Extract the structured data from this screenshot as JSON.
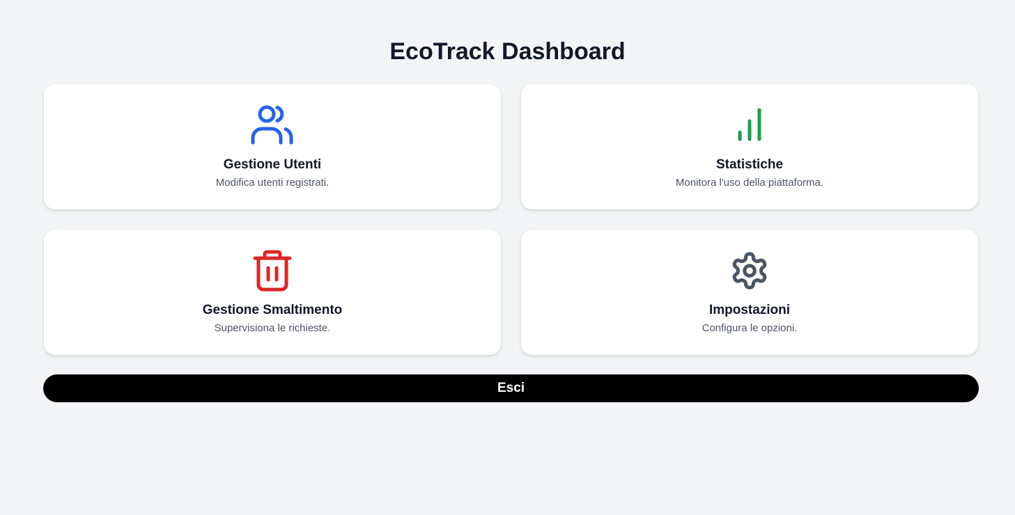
{
  "header": {
    "title": "EcoTrack Dashboard"
  },
  "cards": [
    {
      "title": "Gestione Utenti",
      "description": "Modifica utenti registrati.",
      "icon": "users-icon",
      "icon_color": "#2563eb"
    },
    {
      "title": "Statistiche",
      "description": "Monitora l'uso della piattaforma.",
      "icon": "bar-chart-icon",
      "icon_color": "#16a34a"
    },
    {
      "title": "Gestione Smaltimento",
      "description": "Supervisiona le richieste.",
      "icon": "trash-icon",
      "icon_color": "#dc2626"
    },
    {
      "title": "Impostazioni",
      "description": "Configura le opzioni.",
      "icon": "gear-icon",
      "icon_color": "#4b5563"
    }
  ],
  "logout": {
    "label": "Esci"
  }
}
